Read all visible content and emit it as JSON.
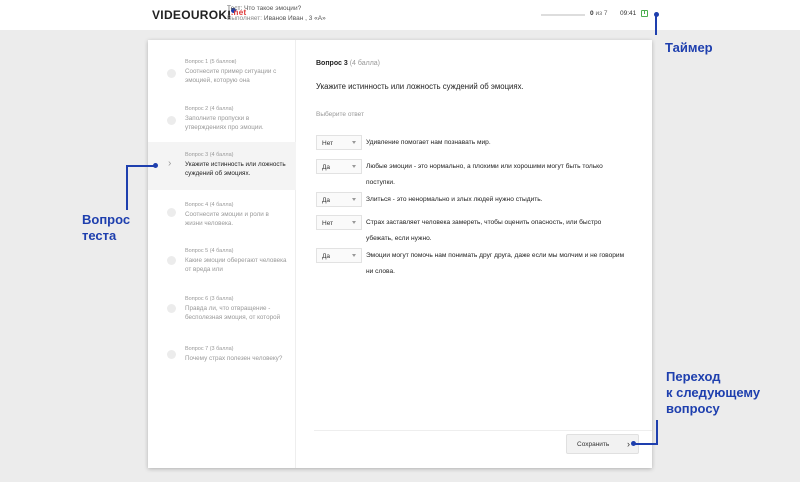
{
  "header": {
    "logo_main": "VIDEOUROKI",
    "logo_suffix": ".net",
    "test_label": "Тест: Что такое эмоции?",
    "user_prefix": "Выполняет:",
    "user_name": "Иванов Иван , 3 «А»",
    "progress_current": "0",
    "progress_suffix": "из 7",
    "progress_fraction": 0.0,
    "timer": "09:41"
  },
  "sidebar": {
    "items": [
      {
        "label": "Вопрос 1 (5 баллов)",
        "text": "Соотнесите пример ситуации с эмоцией, которую она"
      },
      {
        "label": "Вопрос 2 (4 балла)",
        "text": "Заполните пропуски в утверждениях про эмоции."
      },
      {
        "label": "Вопрос 3 (4 балла)",
        "text": "Укажите истинность или ложность суждений об эмоциях."
      },
      {
        "label": "Вопрос 4 (4 балла)",
        "text": "Соотнесите эмоции и роли в жизни человека."
      },
      {
        "label": "Вопрос 5 (4 балла)",
        "text": "Какие эмоции оберегают человека от вреда или"
      },
      {
        "label": "Вопрос 6 (3 балла)",
        "text": "Правда ли, что отвращение - бесполезная эмоция, от которой"
      },
      {
        "label": "Вопрос 7 (3 балла)",
        "text": "Почему страх полезен человеку?"
      }
    ]
  },
  "main": {
    "question_number": "Вопрос 3",
    "question_points": "(4 балла)",
    "question_text": "Укажите истинность или ложность суждений об эмоциях.",
    "choose_label": "Выберите ответ",
    "answers": [
      {
        "value": "Нет",
        "text": "Удивление помогает нам познавать мир."
      },
      {
        "value": "Да",
        "text": "Любые эмоции - это нормально, а плохими или хорошими могут быть только поступки."
      },
      {
        "value": "Да",
        "text": "Злиться - это ненормально и злых людей нужно стыдить."
      },
      {
        "value": "Нет",
        "text": "Страх заставляет человека замереть, чтобы оценить опасность, или быстро убежать, если нужно."
      },
      {
        "value": "Да",
        "text": "Эмоции могут помочь нам понимать друг друга, даже если мы молчим и не говорим ни слова."
      }
    ],
    "save_label": "Сохранить"
  },
  "annotations": {
    "timer": "Таймер",
    "question_line1": "Вопрос",
    "question_line2": "теста",
    "next_line1": "Переход",
    "next_line2": "к следующему",
    "next_line3": "вопросу",
    "color": "#1e3fae"
  }
}
